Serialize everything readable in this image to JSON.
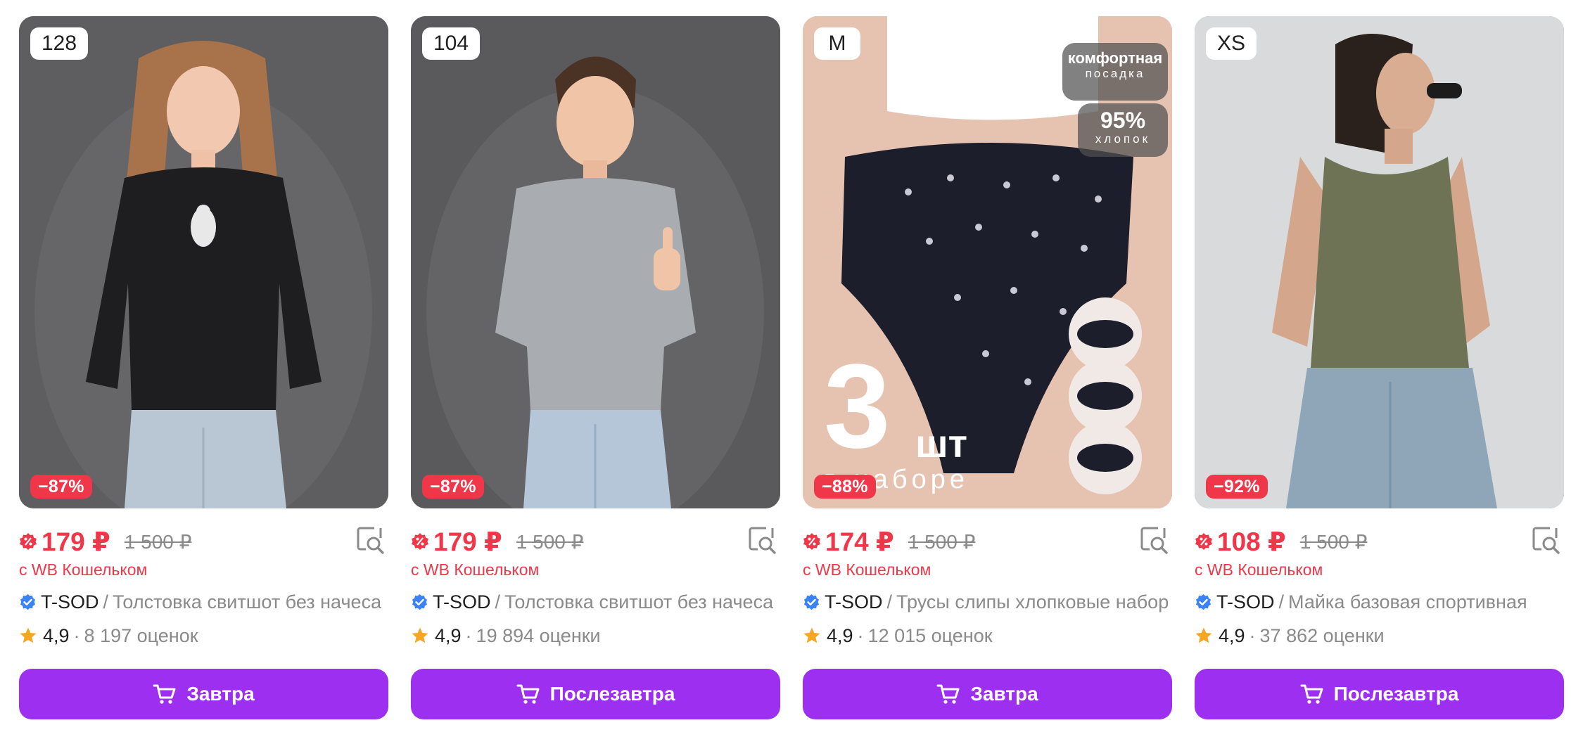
{
  "cards": [
    {
      "size": "128",
      "discount": "−87%",
      "price": "179 ₽",
      "old_price": "1 500 ₽",
      "wallet_note": "с WB Кошельком",
      "brand": "T-SOD",
      "separator": "/",
      "name": "Толстовка свитшот без начеса",
      "rating": "4,9",
      "reviews": "8 197 оценок",
      "delivery": "Завтра"
    },
    {
      "size": "104",
      "discount": "−87%",
      "price": "179 ₽",
      "old_price": "1 500 ₽",
      "wallet_note": "с WB Кошельком",
      "brand": "T-SOD",
      "separator": "/",
      "name": "Толстовка свитшот без начеса",
      "rating": "4,9",
      "reviews": "19 894 оценки",
      "delivery": "Послезавтра"
    },
    {
      "size": "M",
      "discount": "−88%",
      "price": "174 ₽",
      "old_price": "1 500 ₽",
      "wallet_note": "с WB Кошельком",
      "brand": "T-SOD",
      "separator": "/",
      "name": "Трусы слипы хлопковые набор",
      "rating": "4,9",
      "reviews": "12 015 оценок",
      "delivery": "Завтра",
      "promo": {
        "fit_line1": "комфортная",
        "fit_line2": "посадка",
        "cotton_pct": "95%",
        "cotton_word": "хлопок",
        "count": "3",
        "count_unit": "шт",
        "in_set": "в наборе"
      }
    },
    {
      "size": "XS",
      "discount": "−92%",
      "price": "108 ₽",
      "old_price": "1 500 ₽",
      "wallet_note": "с WB Кошельком",
      "brand": "T-SOD",
      "separator": "/",
      "name": "Майка базовая спортивная",
      "rating": "4,9",
      "reviews": "37 862 оценки",
      "delivery": "Послезавтра"
    }
  ],
  "colors": {
    "accent_purple": "#9d2ff0",
    "price_red": "#f0374a",
    "muted_gray": "#8a8a8a",
    "verified_blue": "#3b82f6",
    "star_orange": "#f5a623"
  },
  "icons": {
    "wallet": "wallet-discount-icon",
    "similar": "find-similar-icon",
    "verified": "verified-check-icon",
    "star": "star-icon",
    "cart": "cart-icon"
  }
}
